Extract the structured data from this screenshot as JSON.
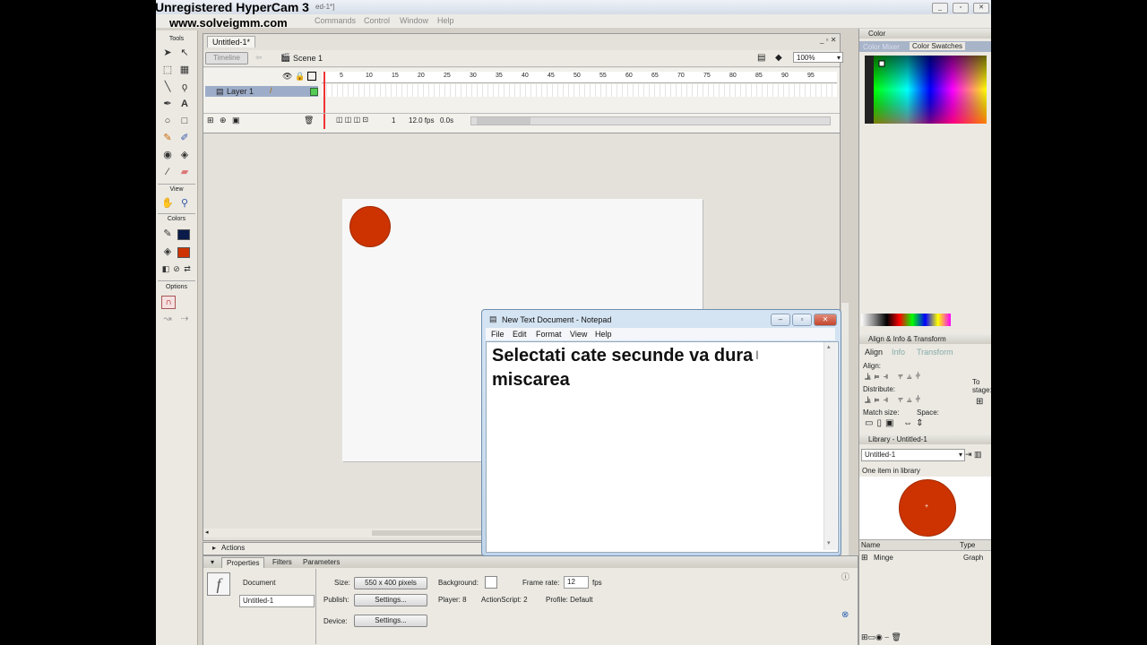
{
  "watermark": {
    "line1": "Unregistered HyperCam 3",
    "line2": "www.solveigmm.com"
  },
  "app": {
    "title_partial": "ed-1*]",
    "menu": [
      "Commands",
      "Control",
      "Window",
      "Help"
    ]
  },
  "tools": {
    "header": "Tools",
    "view_label": "View",
    "colors_label": "Colors",
    "options_label": "Options"
  },
  "document": {
    "tab": "Untitled-1*",
    "timeline_button": "Timeline",
    "scene": "Scene 1",
    "zoom": "100%",
    "layer_name": "Layer 1",
    "ruler_ticks": [
      "5",
      "10",
      "15",
      "20",
      "25",
      "30",
      "35",
      "40",
      "45",
      "50",
      "55",
      "60",
      "65",
      "70",
      "75",
      "80",
      "85",
      "90",
      "95"
    ],
    "frame": "1",
    "fps": "12.0 fps",
    "time": "0.0s"
  },
  "actions_panel": {
    "label": "Actions"
  },
  "properties": {
    "tabs": [
      "Properties",
      "Filters",
      "Parameters"
    ],
    "doc_type": "Document",
    "doc_name": "Untitled-1",
    "size_label": "Size:",
    "size_value": "550 x 400 pixels",
    "background_label": "Background:",
    "frame_rate_label": "Frame rate:",
    "frame_rate_value": "12",
    "fps_unit": "fps",
    "publish_label": "Publish:",
    "settings_button": "Settings...",
    "player": "Player: 8",
    "actionscript": "ActionScript: 2",
    "profile": "Profile: Default",
    "device_label": "Device:",
    "device_button": "Settings..."
  },
  "color_panel": {
    "title": "Color",
    "tabs": [
      "Color Mixer",
      "Color Swatches"
    ]
  },
  "align_panel": {
    "title": "Align & Info & Transform",
    "tabs": [
      "Align",
      "Info",
      "Transform"
    ],
    "align_label": "Align:",
    "distribute_label": "Distribute:",
    "match_size_label": "Match size:",
    "space_label": "Space:",
    "to_stage": "To stage:"
  },
  "library_panel": {
    "title": "Library - Untitled-1",
    "select_value": "Untitled-1",
    "count": "One item in library",
    "col_name": "Name",
    "col_type": "Type",
    "item_name": "Minge",
    "item_type": "Graph"
  },
  "notepad": {
    "title": "New Text Document - Notepad",
    "menu": [
      "File",
      "Edit",
      "Format",
      "View",
      "Help"
    ],
    "text": "Selectati cate secunde va dura miscarea"
  },
  "colors": {
    "ball": "#cc3300",
    "stage": "#f7f7f7",
    "workspace": "#e3e1da",
    "panel_bg": "#ebe9e2"
  }
}
